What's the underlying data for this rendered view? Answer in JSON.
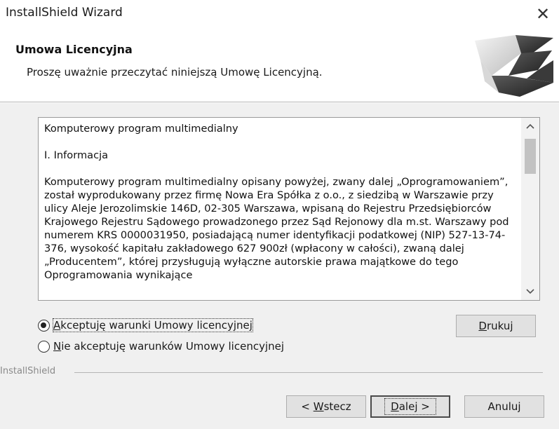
{
  "window": {
    "title": "InstallShield Wizard",
    "close_glyph": "✕"
  },
  "header": {
    "title": "Umowa Licencyjna",
    "subtitle": "Proszę uważnie przeczytać niniejszą Umowę Licencyjną.",
    "logo_icon": "installshield-logo"
  },
  "license": {
    "paragraphs": [
      "Komputerowy program multimedialny",
      "I. Informacja",
      "Komputerowy program multimedialny opisany powyżej, zwany dalej „Oprogramowaniem”, został wyprodukowany przez firmę Nowa Era Spółka z o.o., z siedzibą w Warszawie przy ulicy Aleje Jerozolimskie 146D, 02-305 Warszawa, wpisaną do Rejestru Przedsiębiorców Krajowego Rejestru Sądowego prowadzonego przez Sąd Rejonowy dla m.st. Warszawy pod numerem KRS 0000031950, posiadającą numer identyfikacji podatkowej (NIP) 527-13-74-376, wysokość kapitału zakładowego 627 900zł (wpłacony w całości), zwaną dalej „Producentem”, której przysługują wyłączne autorskie prawa majątkowe do tego Oprogramowania wynikające"
    ]
  },
  "options": {
    "accept": {
      "mnemonic": "A",
      "rest": "kceptuję warunki Umowy licencyjnej",
      "selected": true
    },
    "decline": {
      "mnemonic": "N",
      "rest": "ie akceptuję warunków Umowy licencyjnej",
      "selected": false
    }
  },
  "buttons": {
    "print": {
      "mnemonic": "D",
      "rest": "rukuj"
    },
    "back": {
      "pre": "< ",
      "mnemonic": "W",
      "rest": "stecz"
    },
    "next": {
      "mnemonic": "D",
      "rest": "alej >"
    },
    "cancel": {
      "label": "Anuluj"
    }
  },
  "footer": {
    "brand": "InstallShield"
  },
  "colors": {
    "window_bg": "#f0f0f0",
    "header_bg": "#ffffff",
    "button_bg": "#e1e1e1",
    "brand_text": "#8a8a8a"
  }
}
